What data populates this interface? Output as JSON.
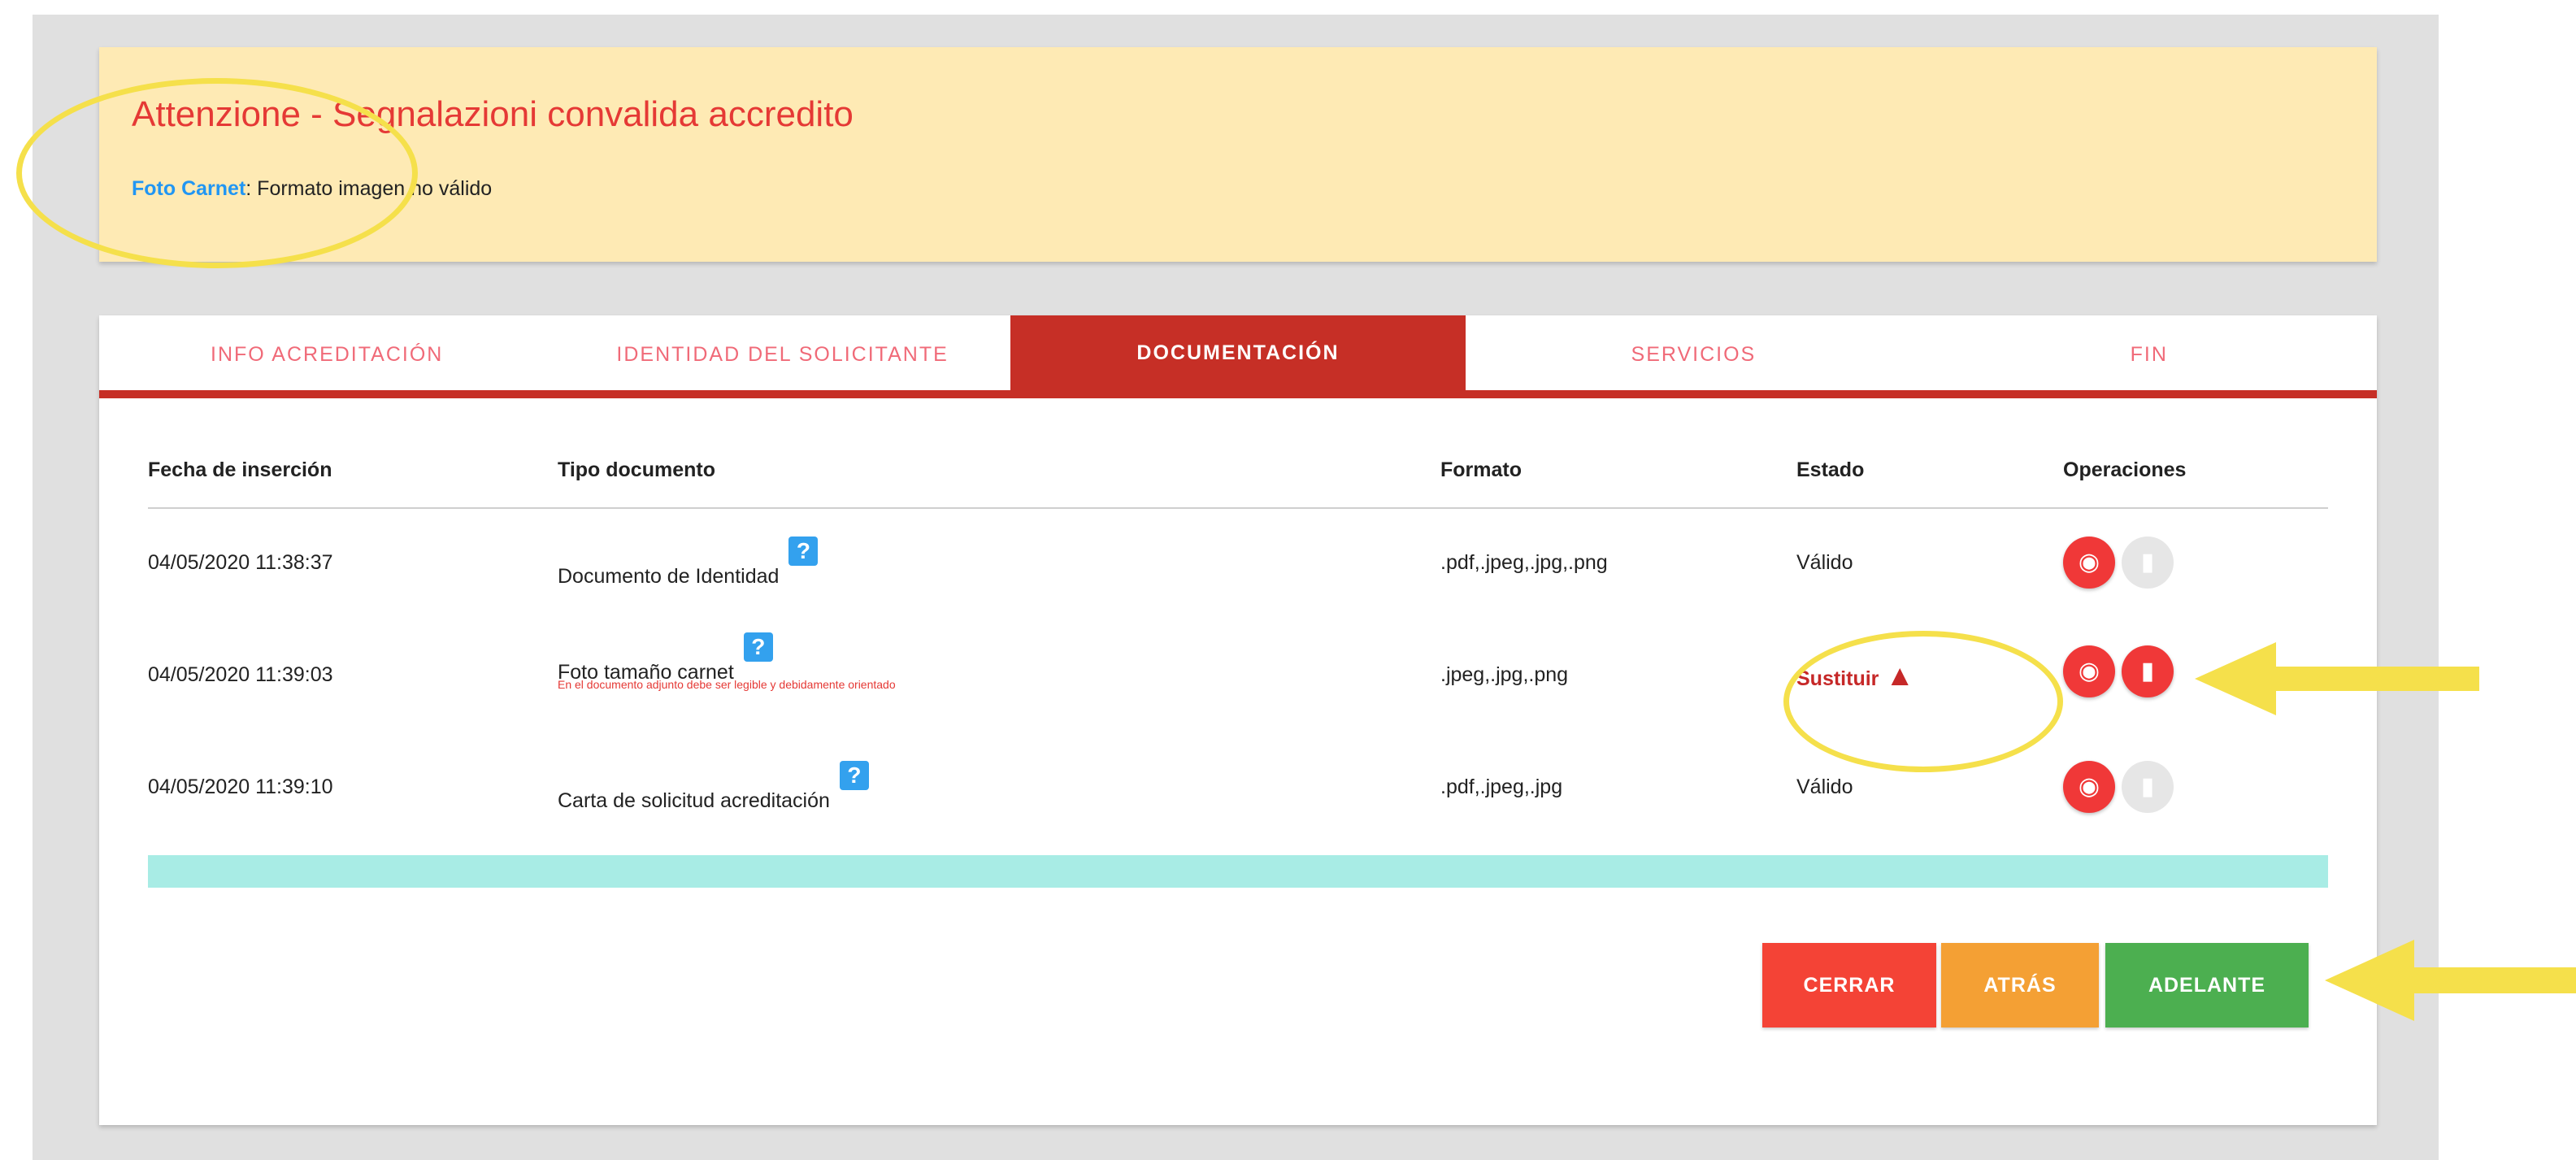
{
  "alert": {
    "title": "Attenzione - Segnalazioni convalida accredito",
    "field": "Foto Carnet",
    "message": ": Formato imagen no válido"
  },
  "tabs": [
    {
      "label": "INFO ACREDITACIÓN"
    },
    {
      "label": "IDENTIDAD DEL SOLICITANTE"
    },
    {
      "label": "DOCUMENTACIÓN"
    },
    {
      "label": "SERVICIOS"
    },
    {
      "label": "FIN"
    }
  ],
  "table": {
    "headers": [
      "Fecha de inserción",
      "Tipo documento",
      "Formato",
      "Estado",
      "Operaciones"
    ],
    "rows": [
      {
        "date": "04/05/2020 11:38:37",
        "type": "Documento de Identidad",
        "note": "",
        "format": ".pdf,.jpeg,.jpg,.png",
        "status": "Válido"
      },
      {
        "date": "04/05/2020 11:39:03",
        "type": "Foto tamaño carnet",
        "note": "En el documento adjunto debe ser legible y debidamente orientado",
        "format": ".jpeg,.jpg,.png",
        "status": "Sustituir"
      },
      {
        "date": "04/05/2020 11:39:10",
        "type": "Carta de solicitud acreditación",
        "note": "",
        "format": ".pdf,.jpeg,.jpg",
        "status": "Válido"
      }
    ]
  },
  "buttons": {
    "close": "CERRAR",
    "back": "ATRÁS",
    "next": "ADELANTE"
  },
  "icons": {
    "help": "help-icon",
    "view": "eye-icon",
    "delete": "trash-icon",
    "warning": "warning-icon"
  },
  "colors": {
    "accent": "#c62f26",
    "alert_bg": "#feeab4",
    "annotation": "#f5e04b"
  }
}
